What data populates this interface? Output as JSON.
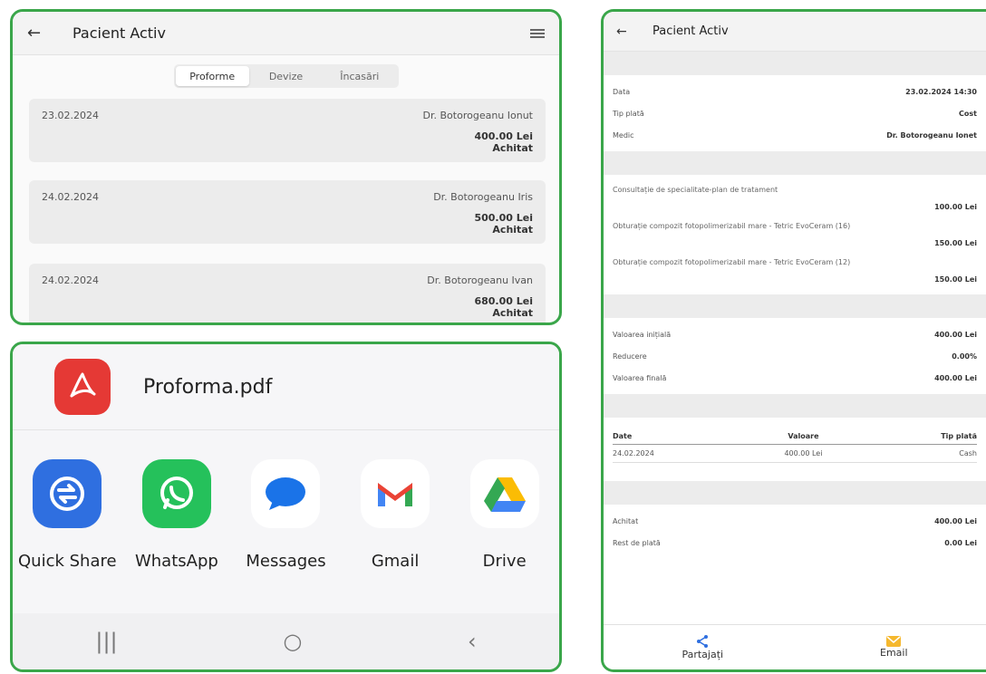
{
  "list_screen": {
    "title": "Pacient Activ",
    "tabs": [
      "Proforme",
      "Devize",
      "Încasări"
    ],
    "cards": [
      {
        "date": "23.02.2024",
        "doctor": "Dr. Botorogeanu Ionut",
        "amount": "400.00 Lei",
        "status": "Achitat"
      },
      {
        "date": "24.02.2024",
        "doctor": "Dr. Botorogeanu Iris",
        "amount": "500.00 Lei",
        "status": "Achitat"
      },
      {
        "date": "24.02.2024",
        "doctor": "Dr. Botorogeanu Ivan",
        "amount": "680.00 Lei",
        "status": "Achitat"
      }
    ]
  },
  "share_sheet": {
    "file_name": "Proforma.pdf",
    "apps": [
      {
        "label": "Quick Share",
        "icon": "quick-share-icon",
        "color": "#2f6fe0"
      },
      {
        "label": "WhatsApp",
        "icon": "whatsapp-icon",
        "color": "#25c15b"
      },
      {
        "label": "Messages",
        "icon": "messages-icon",
        "color": "#1a73e8"
      },
      {
        "label": "Gmail",
        "icon": "gmail-icon",
        "color": "#ea4335"
      },
      {
        "label": "Drive",
        "icon": "drive-icon",
        "color": "#fbbc04"
      }
    ],
    "nav": [
      "|||",
      "○",
      "‹"
    ]
  },
  "detail_screen": {
    "title": "Pacient Activ",
    "info": [
      {
        "label": "Data",
        "value": "23.02.2024 14:30"
      },
      {
        "label": "Tip plată",
        "value": "Cost"
      },
      {
        "label": "Medic",
        "value": "Dr. Botorogeanu Ionet"
      }
    ],
    "items": [
      {
        "desc": "Consultație de specialitate-plan de tratament",
        "value": "100.00 Lei"
      },
      {
        "desc": "Obturație compozit fotopolimerizabil mare - Tetric EvoCeram (16)",
        "value": "150.00 Lei"
      },
      {
        "desc": "Obturație compozit fotopolimerizabil mare - Tetric EvoCeram (12)",
        "value": "150.00 Lei"
      }
    ],
    "totals": [
      {
        "label": "Valoarea inițială",
        "value": "400.00 Lei"
      },
      {
        "label": "Reducere",
        "value": "0.00%"
      },
      {
        "label": "Valoarea finală",
        "value": "400.00 Lei"
      }
    ],
    "payments_header": [
      "Date",
      "Valoare",
      "Tip plată"
    ],
    "payments": [
      [
        "24.02.2024",
        "400.00 Lei",
        "Cash"
      ]
    ],
    "summary": [
      {
        "label": "Achitat",
        "value": "400.00 Lei"
      },
      {
        "label": "Rest de plată",
        "value": "0.00 Lei"
      }
    ],
    "share_label": "Partajați",
    "email_label": "Email"
  }
}
